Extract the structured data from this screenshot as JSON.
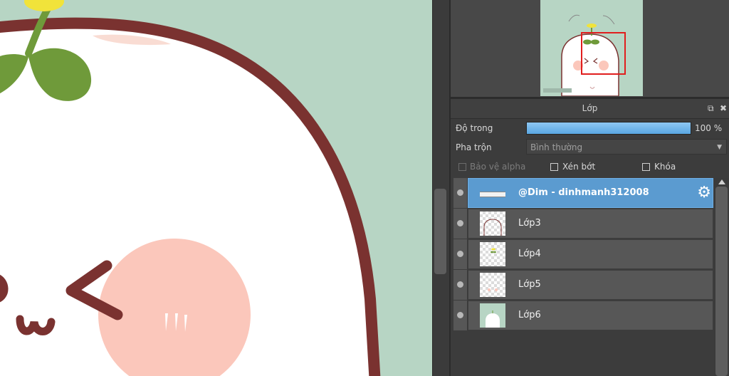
{
  "layer_panel": {
    "title": "Lớp",
    "opacity_label": "Độ trong",
    "opacity_value": "100 %",
    "opacity_level": 1.0,
    "blend_label": "Pha trộn",
    "blend_value": "Bình thường",
    "checkboxes": {
      "protect_alpha": "Bảo vệ alpha",
      "clipping": "Xén bớt",
      "lock": "Khóa"
    },
    "layers": [
      {
        "name": "@Dim - dinhmanh312008",
        "selected": true
      },
      {
        "name": "Lớp3",
        "selected": false
      },
      {
        "name": "Lớp4",
        "selected": false
      },
      {
        "name": "Lớp5",
        "selected": false
      },
      {
        "name": "Lớp6",
        "selected": false
      }
    ]
  },
  "colors": {
    "canvas_background": "#b7d5c4",
    "outline": "#7a3230",
    "blush": "#fbc7bb",
    "leaf": "#6f9a3a",
    "selected_layer": "#5b9bd0",
    "opacity_fill": "#6ab3ea"
  },
  "icons": {
    "header_popout": "popout-icon",
    "header_close": "close-icon",
    "layer_settings": "gear-icon",
    "visibility": "eye-dot-icon"
  }
}
